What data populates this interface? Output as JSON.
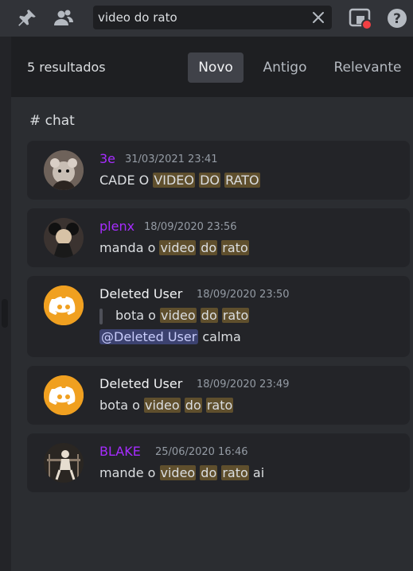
{
  "topbar": {
    "pin_icon": "pin-icon",
    "members_icon": "members-icon",
    "search_value": "video do rato",
    "clear_icon": "close-icon",
    "inbox_icon": "inbox-icon",
    "help_icon": "help-icon"
  },
  "results": {
    "count_label": "5 resultados",
    "tabs": [
      {
        "label": "Novo",
        "active": true
      },
      {
        "label": "Antigo",
        "active": false
      },
      {
        "label": "Relevante",
        "active": false
      }
    ],
    "channel": "# chat"
  },
  "messages": [
    {
      "author": "3e",
      "author_color": "#a62cff",
      "timestamp": "31/03/2021 23:41",
      "parts": [
        [
          "CADE O ",
          false
        ],
        [
          "VIDEO",
          true
        ],
        [
          " ",
          false
        ],
        [
          "DO",
          true
        ],
        [
          " ",
          false
        ],
        [
          "RATO",
          true
        ]
      ]
    },
    {
      "author": "plenx",
      "author_color": "#a62cff",
      "timestamp": "18/09/2020 23:56",
      "parts": [
        [
          "manda o ",
          false
        ],
        [
          "video",
          true
        ],
        [
          " ",
          false
        ],
        [
          "do",
          true
        ],
        [
          " ",
          false
        ],
        [
          "rato",
          true
        ]
      ]
    },
    {
      "author": "Deleted User",
      "author_color": "#f2f3f5",
      "timestamp": "18/09/2020 23:50",
      "quote_parts": [
        [
          "bota o ",
          false
        ],
        [
          "video",
          true
        ],
        [
          " ",
          false
        ],
        [
          "do",
          true
        ],
        [
          " ",
          false
        ],
        [
          "rato",
          true
        ]
      ],
      "mention": "@Deleted User",
      "after_mention": " calma"
    },
    {
      "author": "Deleted User",
      "author_color": "#f2f3f5",
      "timestamp": "18/09/2020 23:49",
      "parts": [
        [
          "bota o ",
          false
        ],
        [
          "video",
          true
        ],
        [
          " ",
          false
        ],
        [
          "do",
          true
        ],
        [
          " ",
          false
        ],
        [
          "rato",
          true
        ]
      ]
    },
    {
      "author": "BLAKE",
      "author_color": "#a62cff",
      "timestamp": "25/06/2020 16:46",
      "parts": [
        [
          "mande o ",
          false
        ],
        [
          "video",
          true
        ],
        [
          " ",
          false
        ],
        [
          "do",
          true
        ],
        [
          " ",
          false
        ],
        [
          "rato",
          true
        ],
        [
          " ai",
          false
        ]
      ]
    }
  ],
  "colors": {
    "accent_purple": "#a62cff",
    "discord_logo_bg": "#f0a020",
    "highlight": "#5f4f2d",
    "mention": "#3c4270",
    "inbox_dot": "#f23f43"
  }
}
